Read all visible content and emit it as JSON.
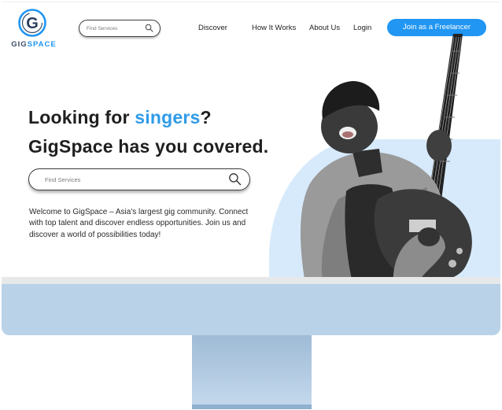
{
  "header": {
    "logo_letter": "G",
    "logo_text_a": "GIG",
    "logo_text_b": "SPACE",
    "search_placeholder": "Find Services",
    "nav": [
      "Discover",
      "How It Works",
      "About Us",
      "Login"
    ],
    "cta_label": "Join as a Freelancer"
  },
  "hero": {
    "headline_prefix": "Looking for ",
    "headline_highlight": "singers",
    "headline_suffix": "?",
    "headline_line2": "GigSpace has you covered.",
    "search_placeholder": "Find Services",
    "description": "Welcome to GigSpace – Asia's largest gig community. Connect with top talent and discover endless opportunities. Join us and discover a world of possibilities today!"
  },
  "icons": {
    "search": "search-icon",
    "logo": "gigspace-logo"
  },
  "colors": {
    "accent": "#2196f3",
    "highlight": "#2f9be8",
    "hero_bg": "#d7eafb",
    "monitor": "#b9d2e8"
  }
}
